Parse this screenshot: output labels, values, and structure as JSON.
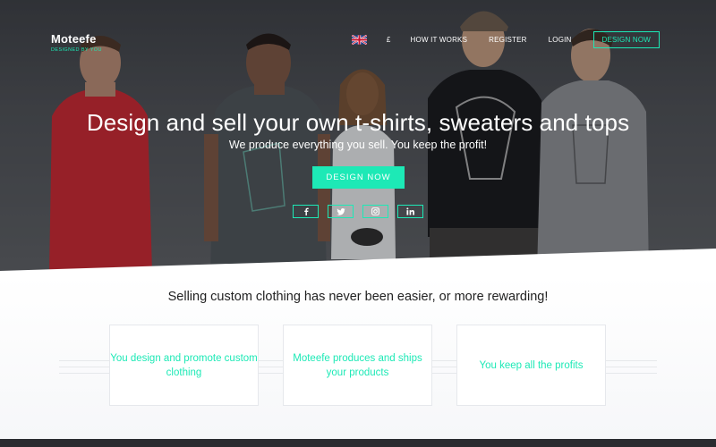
{
  "brand": {
    "name": "Moteefe",
    "tagline": "DESIGNED BY YOU",
    "accent": "#1de9b6"
  },
  "nav": {
    "flag_icon": "uk-flag-icon",
    "currency": "£",
    "how_it_works": "HOW IT WORKS",
    "register": "REGISTER",
    "login": "LOGIN",
    "design_now": "DESIGN NOW"
  },
  "hero": {
    "headline": "Design and sell your own t-shirts, sweaters and tops",
    "subline": "We produce everything you sell. You keep the profit!",
    "cta_label": "DESIGN NOW",
    "social": [
      "facebook-icon",
      "twitter-icon",
      "instagram-icon",
      "linkedin-icon"
    ]
  },
  "features": {
    "title": "Selling custom clothing has never been easier, or more rewarding!",
    "cards": [
      {
        "text": "You design and promote custom clothing"
      },
      {
        "text": "Moteefe produces and ships your products"
      },
      {
        "text": "You keep all the profits"
      }
    ]
  }
}
